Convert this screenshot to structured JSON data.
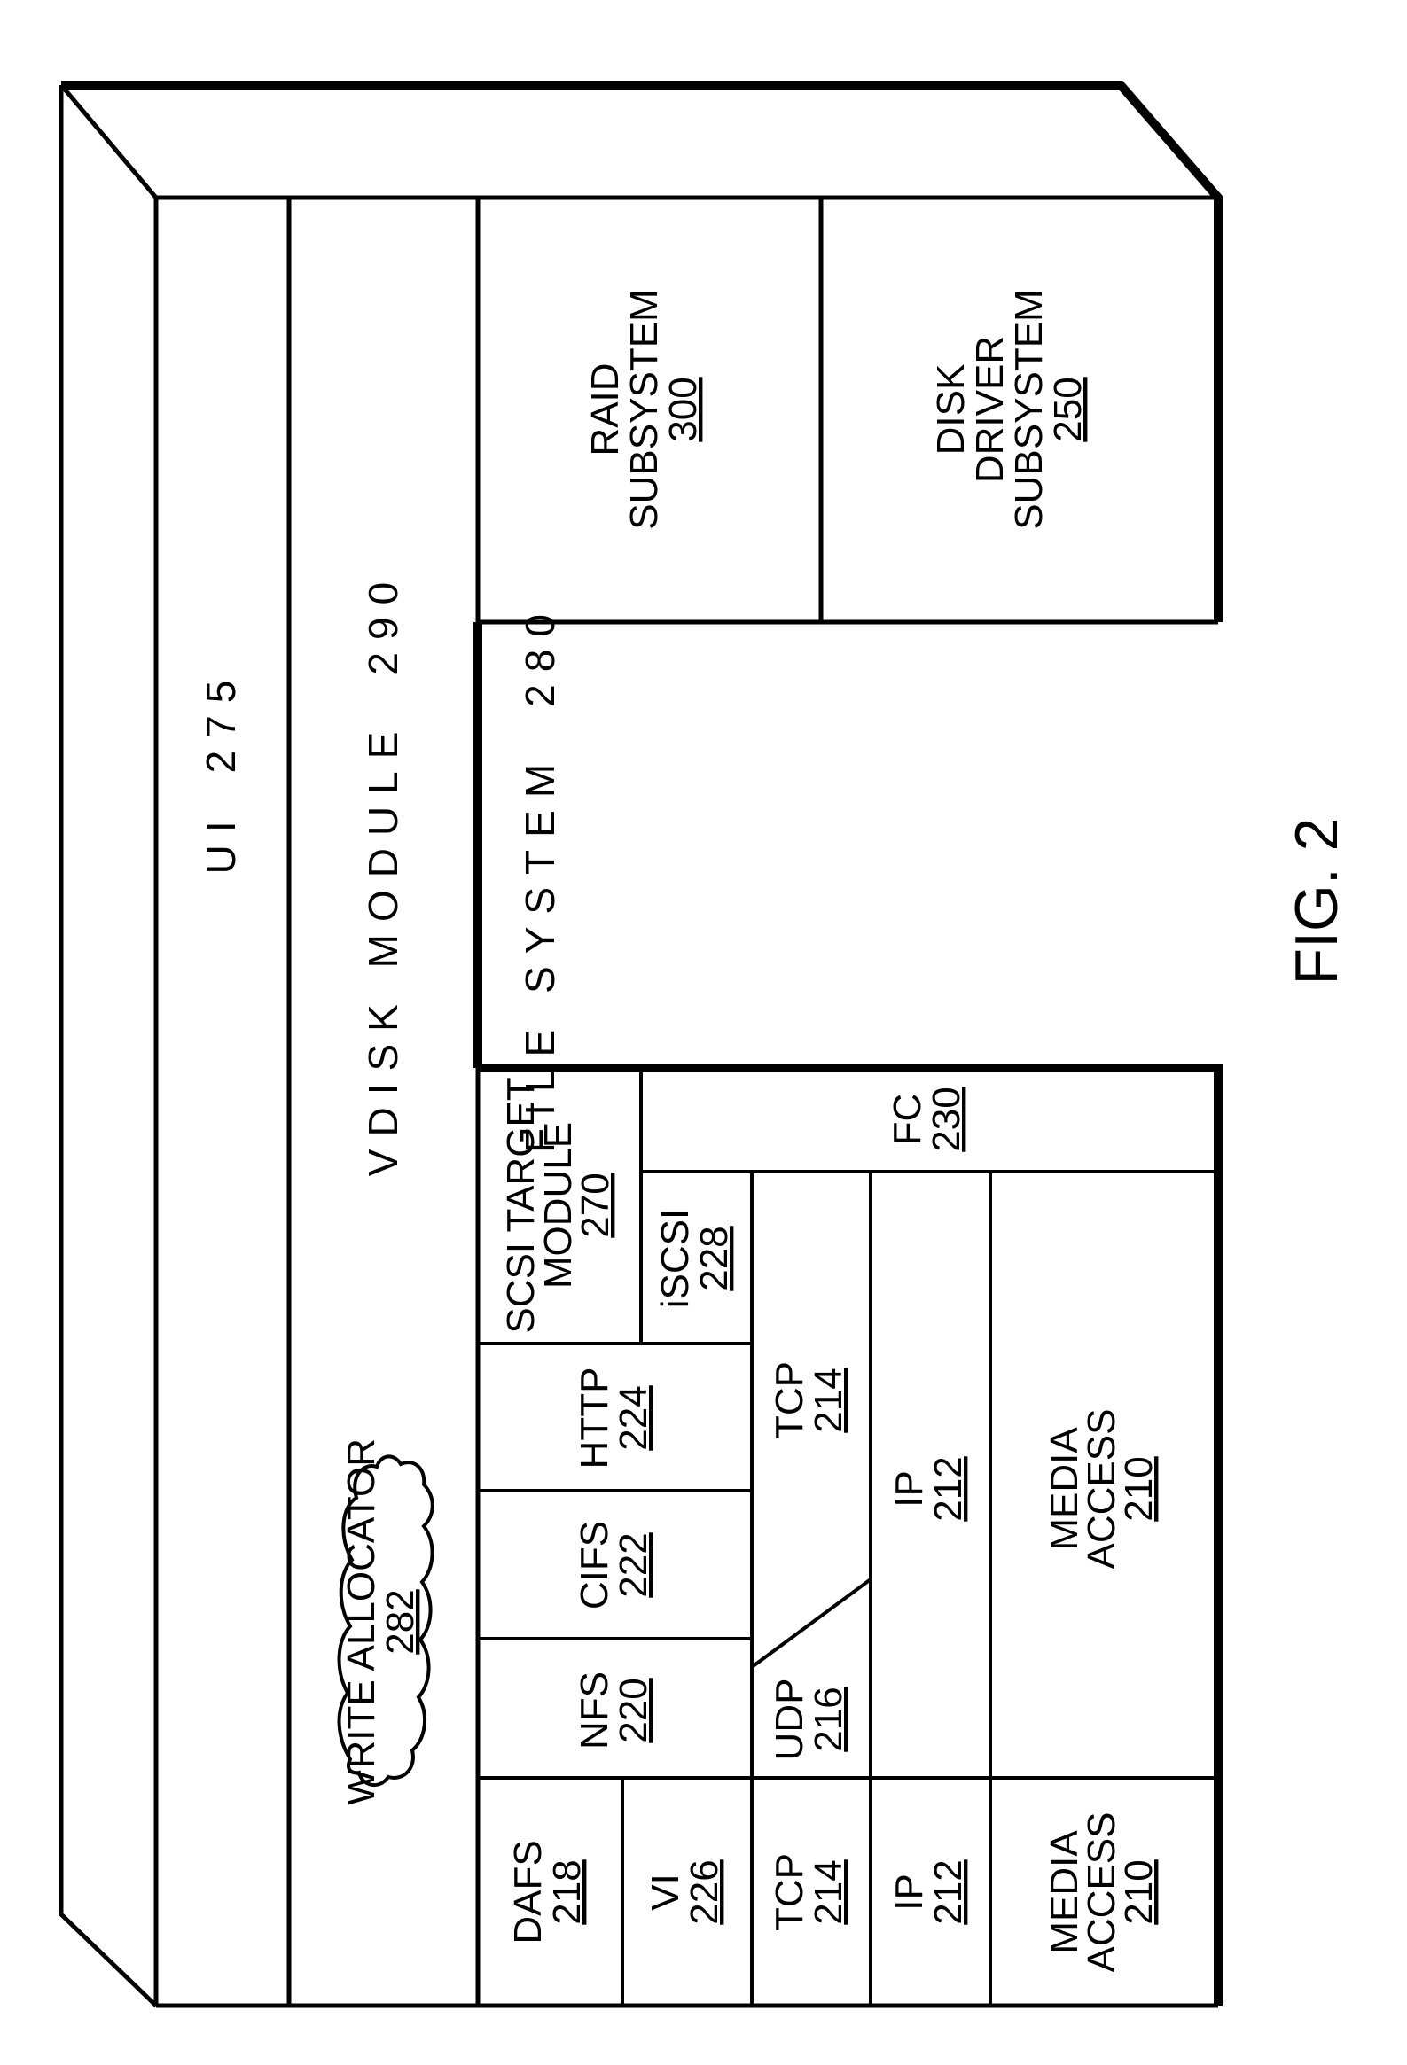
{
  "figure": {
    "caption": "FIG. 2",
    "line_color": "#000000",
    "background": "#ffffff"
  },
  "layers": {
    "ui": {
      "label": "UI",
      "ref": "275"
    },
    "vdisk": {
      "label": "VDISK MODULE",
      "ref": "290"
    },
    "file_system": {
      "label": "FILE SYSTEM",
      "ref": "280"
    },
    "write_allocator": {
      "label": "WRITE ALLOCATOR",
      "ref": "282"
    },
    "raid": {
      "lines": [
        "RAID",
        "SUBSYSTEM"
      ],
      "ref": "300"
    },
    "disk_driver": {
      "lines": [
        "DISK",
        "DRIVER",
        "SUBSYSTEM"
      ],
      "ref": "250"
    },
    "scsi_target": {
      "lines": [
        "SCSI TARGET",
        "MODULE"
      ],
      "ref": "270"
    },
    "fc": {
      "label": "FC",
      "ref": "230"
    },
    "iscsi": {
      "label": "iSCSI",
      "ref": "228"
    },
    "http": {
      "label": "HTTP",
      "ref": "224"
    },
    "cifs": {
      "label": "CIFS",
      "ref": "222"
    },
    "nfs": {
      "label": "NFS",
      "ref": "220"
    },
    "tcp_main": {
      "label": "TCP",
      "ref": "214"
    },
    "udp": {
      "label": "UDP",
      "ref": "216"
    },
    "ip_main": {
      "label": "IP",
      "ref": "212"
    },
    "media_main": {
      "lines": [
        "MEDIA",
        "ACCESS"
      ],
      "ref": "210"
    },
    "dafs": {
      "label": "DAFS",
      "ref": "218"
    },
    "vi": {
      "label": "VI",
      "ref": "226"
    },
    "tcp_vi": {
      "label": "TCP",
      "ref": "214"
    },
    "ip_vi": {
      "label": "IP",
      "ref": "212"
    },
    "media_vi": {
      "lines": [
        "MEDIA",
        "ACCESS"
      ],
      "ref": "210"
    }
  }
}
